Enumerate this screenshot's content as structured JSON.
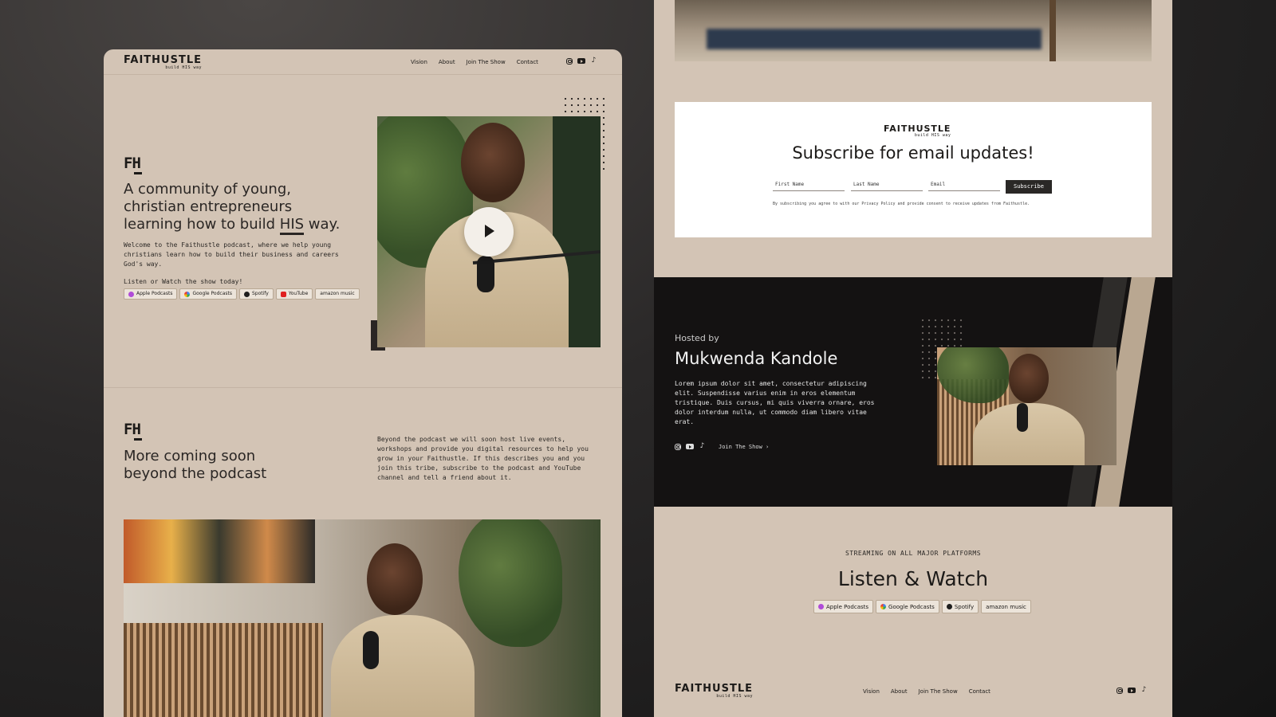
{
  "brand": {
    "name": "FAITHUSTLE",
    "tagline": "build HIS way",
    "monogram": "FH"
  },
  "nav": {
    "links": [
      "Vision",
      "About",
      "Join The Show",
      "Contact"
    ]
  },
  "social_icons": [
    "instagram-icon",
    "youtube-icon",
    "tiktok-icon"
  ],
  "hero": {
    "title_pre": "A community of young, christian entrepreneurs learning how to build ",
    "title_em": "HIS",
    "title_post": " way.",
    "body": "Welcome to the Faithustle podcast, where we help young christians learn how to build their business and careers God's way.",
    "listen_label": "Listen or Watch the show today!",
    "platforms": [
      "Apple Podcasts",
      "Google Podcasts",
      "Spotify",
      "YouTube",
      "amazon music"
    ]
  },
  "more": {
    "title": "More coming soon beyond the podcast",
    "body": "Beyond the podcast we will soon host live events, workshops and provide you digital resources to help you grow in your Faithustle. If this describes you and you join this tribe, subscribe to the podcast and YouTube channel and tell a friend about it."
  },
  "subscribe": {
    "title": "Subscribe for email updates!",
    "first_name_placeholder": "First Name",
    "last_name_placeholder": "Last Name",
    "email_placeholder": "Email",
    "button": "Subscribe",
    "disclaimer": "By subscribing you agree to with our Privacy Policy and provide consent to receive updates from Faithustle."
  },
  "host": {
    "label": "Hosted by",
    "name": "Mukwenda Kandole",
    "bio": "Lorem ipsum dolor sit amet, consectetur adipiscing elit. Suspendisse varius enim in eros elementum tristique. Duis cursus, mi quis viverra ornare, eros dolor interdum nulla, ut commodo diam libero vitae erat.",
    "cta": "Join The Show"
  },
  "streaming": {
    "eyebrow": "STREAMING ON ALL MAJOR PLATFORMS",
    "title": "Listen & Watch",
    "platforms": [
      "Apple Podcasts",
      "Google Podcasts",
      "Spotify",
      "amazon music"
    ]
  },
  "colors": {
    "panel_tan": "#d3c4b5",
    "dark_section": "#141212",
    "ink": "#1c1a18",
    "apple_purple": "#b04cd8",
    "spotify_dark": "#1e1e1e",
    "youtube_red": "#e02020"
  }
}
